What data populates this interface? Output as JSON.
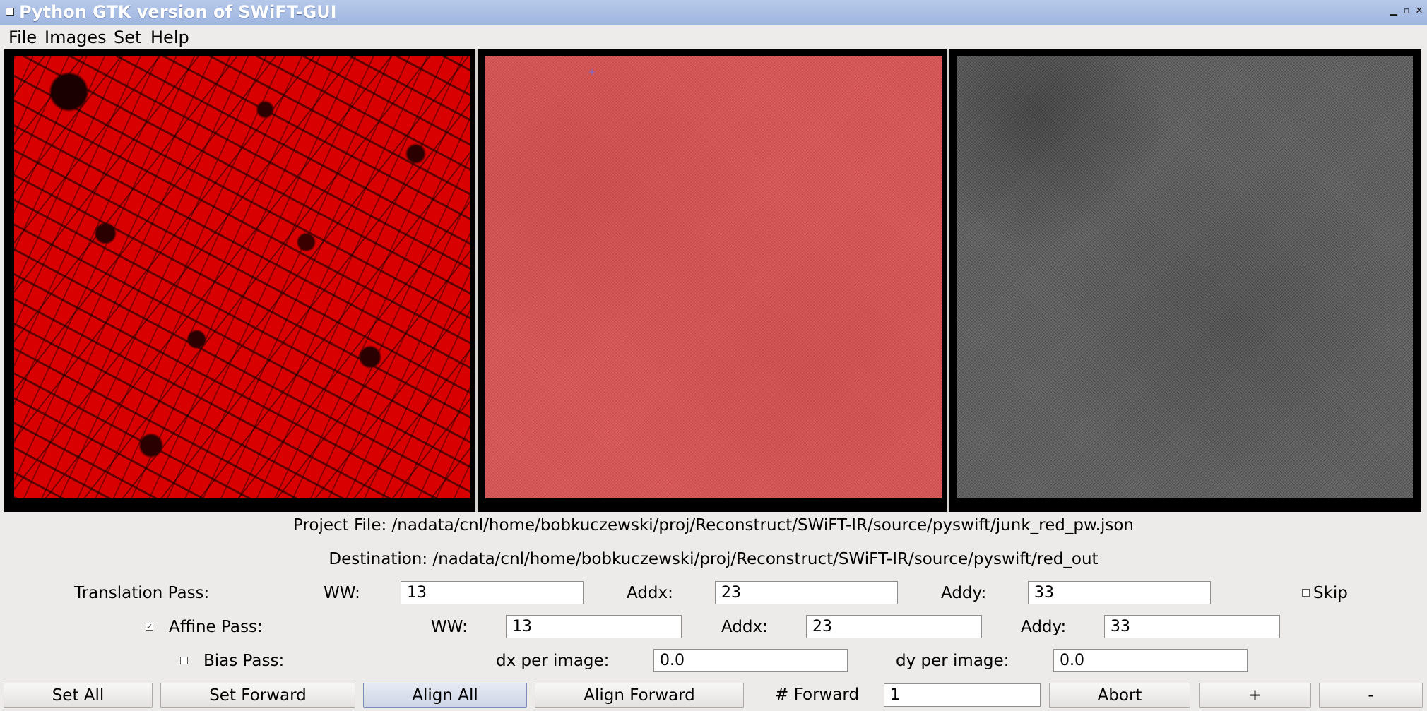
{
  "window": {
    "title": "Python GTK version of SWiFT-GUI",
    "controls": {
      "minimize": "▁",
      "maximize": "▫",
      "close": "✕"
    }
  },
  "menu": {
    "items": [
      "File",
      "Images",
      "Set",
      "Help"
    ]
  },
  "images": {
    "panes": [
      {
        "name": "reference-image",
        "color": "#d80000"
      },
      {
        "name": "aligned-image",
        "color": "#dc5e5e"
      },
      {
        "name": "difference-image",
        "color": "#6c6c6c"
      }
    ],
    "cursor_marker": "+"
  },
  "info": {
    "project_file": "Project File: /nadata/cnl/home/bobkuczewski/proj/Reconstruct/SWiFT-IR/source/pyswift/junk_red_pw.json",
    "destination": "Destination: /nadata/cnl/home/bobkuczewski/proj/Reconstruct/SWiFT-IR/source/pyswift/red_out"
  },
  "translation": {
    "label": "Translation Pass:",
    "ww_label": "WW:",
    "ww": "13",
    "addx_label": "Addx:",
    "addx": "23",
    "addy_label": "Addy:",
    "addy": "33",
    "skip_label": "Skip",
    "skip_checked": false
  },
  "affine": {
    "label": "Affine Pass:",
    "checked": true,
    "ww_label": "WW:",
    "ww": "13",
    "addx_label": "Addx:",
    "addx": "23",
    "addy_label": "Addy:",
    "addy": "33"
  },
  "bias": {
    "label": "Bias Pass:",
    "checked": false,
    "dx_label": "dx per image:",
    "dx": "0.0",
    "dy_label": "dy per image:",
    "dy": "0.0"
  },
  "buttons": {
    "set_all": "Set All",
    "set_forward": "Set Forward",
    "align_all": "Align All",
    "align_forward": "Align Forward",
    "forward_label": "# Forward",
    "forward_count": "1",
    "abort": "Abort",
    "plus": "+",
    "minus": "-"
  }
}
